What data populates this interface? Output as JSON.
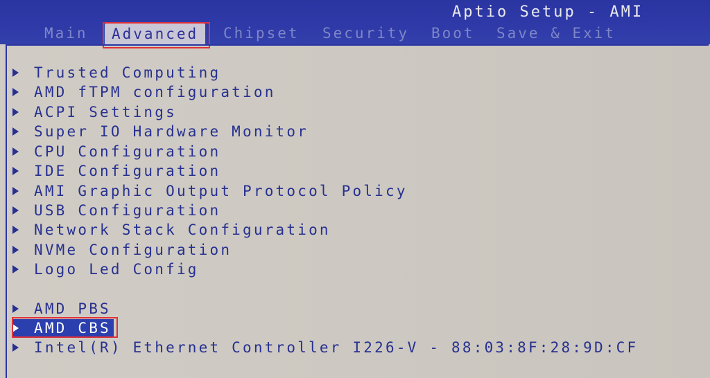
{
  "app": {
    "title": "Aptio Setup - AMI"
  },
  "tabs": [
    {
      "label": "Main"
    },
    {
      "label": "Advanced"
    },
    {
      "label": "Chipset"
    },
    {
      "label": "Security"
    },
    {
      "label": "Boot"
    },
    {
      "label": "Save & Exit"
    }
  ],
  "active_tab": "Advanced",
  "menu": {
    "items": [
      {
        "label": "Trusted Computing"
      },
      {
        "label": "AMD fTPM configuration"
      },
      {
        "label": "ACPI Settings"
      },
      {
        "label": "Super IO Hardware Monitor"
      },
      {
        "label": "CPU Configuration"
      },
      {
        "label": "IDE Configuration"
      },
      {
        "label": "AMI Graphic Output Protocol Policy"
      },
      {
        "label": "USB Configuration"
      },
      {
        "label": "Network Stack Configuration"
      },
      {
        "label": "NVMe Configuration"
      },
      {
        "label": "Logo Led Config"
      },
      {
        "label": "AMD PBS"
      },
      {
        "label": "AMD CBS"
      },
      {
        "label": "Intel(R) Ethernet Controller I226-V - 88:03:8F:28:9D:CF"
      }
    ],
    "selected": "AMD CBS"
  },
  "colors": {
    "header_blue": "#2a35a2",
    "text_blue": "#27308f",
    "highlight_red": "#e0313a"
  }
}
